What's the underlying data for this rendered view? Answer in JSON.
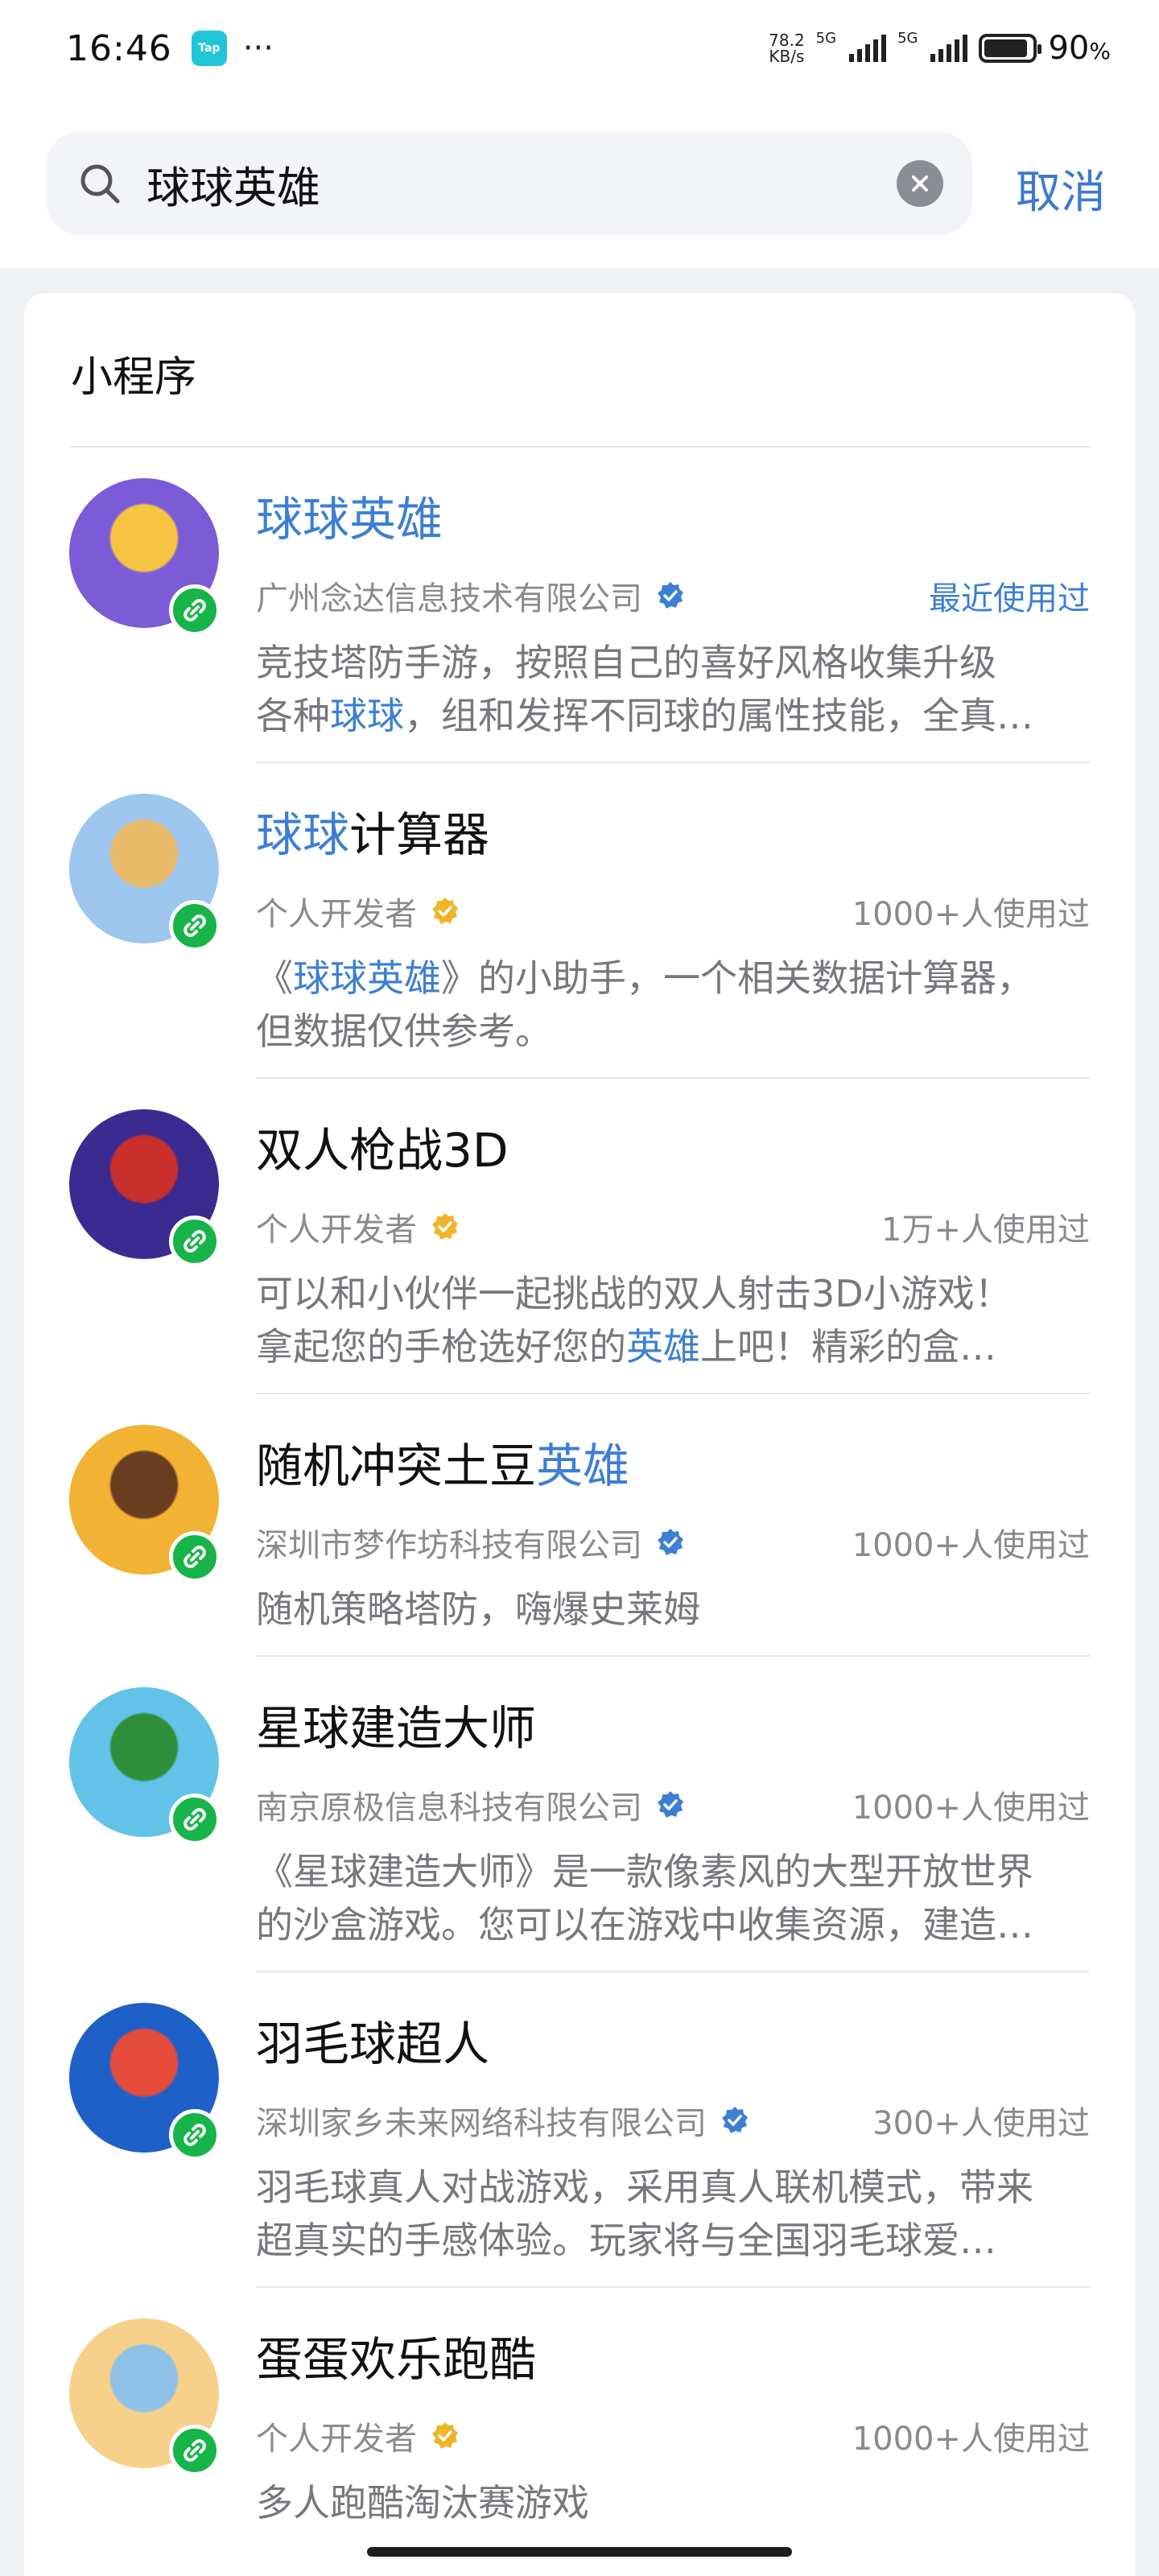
{
  "status_bar": {
    "time": "16:46",
    "app_badge": "Tap",
    "more": "···",
    "net_speed_value": "78.2",
    "net_speed_unit": "KB/s",
    "sim1": "5G",
    "sim2": "5G",
    "battery_percent": "90",
    "battery_unit": "%",
    "battery_level": 0.9
  },
  "search": {
    "query": "球球英雄",
    "cancel_label": "取消"
  },
  "section": {
    "title": "小程序"
  },
  "results": [
    {
      "name_parts": [
        "",
        "球球英雄",
        ""
      ],
      "publisher": "广州念达信息技术有限公司",
      "verify_color": "#3c7fd4",
      "usage": "最近使用过",
      "desc_line1": [
        "竞技塔防手游，按照自己的喜好风格收集升级",
        "",
        ""
      ],
      "desc_line2": [
        "各种",
        "球球",
        "，组和发挥不同球的属性技能，全真…"
      ]
    },
    {
      "name_parts": [
        "",
        "球球",
        "计算器"
      ],
      "publisher": "个人开发者",
      "verify_color": "#f0b429",
      "usage": "1000+人使用过",
      "desc_line1": [
        "《",
        "球球英雄",
        "》的小助手，一个相关数据计算器，"
      ],
      "desc_line2": [
        "但数据仅供参考。",
        "",
        ""
      ]
    },
    {
      "name_parts": [
        "双人枪战3D",
        "",
        ""
      ],
      "publisher": "个人开发者",
      "verify_color": "#f0b429",
      "usage": "1万+人使用过",
      "desc_line1": [
        "可以和小伙伴一起挑战的双人射击3D小游戏！",
        "",
        ""
      ],
      "desc_line2": [
        "拿起您的手枪选好您的",
        "英雄",
        "上吧！精彩的盒…"
      ]
    },
    {
      "name_parts": [
        "随机冲突土豆",
        "英雄",
        ""
      ],
      "publisher": "深圳市梦作坊科技有限公司",
      "verify_color": "#3c7fd4",
      "usage": "1000+人使用过",
      "desc_line1": [
        "随机策略塔防，嗨爆史莱姆",
        "",
        ""
      ],
      "desc_line2": [
        "",
        "",
        ""
      ]
    },
    {
      "name_parts": [
        "星球建造大师",
        "",
        ""
      ],
      "publisher": "南京原极信息科技有限公司",
      "verify_color": "#3c7fd4",
      "usage": "1000+人使用过",
      "desc_line1": [
        "《星球建造大师》是一款像素风的大型开放世界",
        "",
        ""
      ],
      "desc_line2": [
        "的沙盒游戏。您可以在游戏中收集资源，建造…",
        "",
        ""
      ]
    },
    {
      "name_parts": [
        "羽毛球超人",
        "",
        ""
      ],
      "publisher": "深圳家乡未来网络科技有限公司",
      "verify_color": "#3c7fd4",
      "usage": "300+人使用过",
      "desc_line1": [
        "羽毛球真人对战游戏，采用真人联机模式，带来",
        "",
        ""
      ],
      "desc_line2": [
        "超真实的手感体验。玩家将与全国羽毛球爱…",
        "",
        ""
      ]
    },
    {
      "name_parts": [
        "蛋蛋欢乐跑酷",
        "",
        ""
      ],
      "publisher": "个人开发者",
      "verify_color": "#f0b429",
      "usage": "1000+人使用过",
      "desc_line1": [
        "多人跑酷淘汰赛游戏",
        "",
        ""
      ],
      "desc_line2": [
        "",
        "",
        ""
      ]
    }
  ],
  "avatars": [
    {
      "bg": "#7b5cd6",
      "accent": "#f5c542"
    },
    {
      "bg": "#9cc6ee",
      "accent": "#e9b96a"
    },
    {
      "bg": "#3b2a8f",
      "accent": "#c9302c"
    },
    {
      "bg": "#f2b233",
      "accent": "#6b3d1f"
    },
    {
      "bg": "#63c2e8",
      "accent": "#2f8f3a"
    },
    {
      "bg": "#1f5fc8",
      "accent": "#e64c3c"
    },
    {
      "bg": "#f7d08a",
      "accent": "#8ec0e8"
    }
  ],
  "badge_icon": "mini-program-link-icon"
}
